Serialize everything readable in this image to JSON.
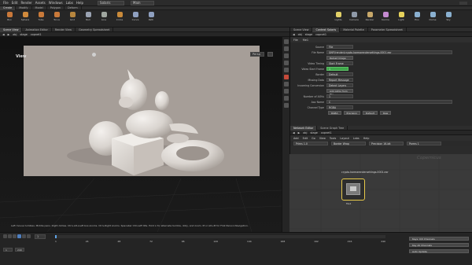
{
  "menu": {
    "items": [
      "File",
      "Edit",
      "Render",
      "Assets",
      "Windows",
      "Labs",
      "Help"
    ],
    "desktop": "Solaris",
    "context": "Main"
  },
  "shelf": {
    "tabs": [
      "Create",
      "Modify",
      "Model",
      "Polygon",
      "Deform"
    ],
    "tools": [
      {
        "label": "Box",
        "color": "#c9783a"
      },
      {
        "label": "Sphere",
        "color": "#d08a3c"
      },
      {
        "label": "Tube",
        "color": "#c97a3a"
      },
      {
        "label": "Torus",
        "color": "#c97a3a"
      },
      {
        "label": "Grid",
        "color": "#b7863e"
      },
      {
        "label": "Null",
        "color": "#9aa3b2"
      },
      {
        "label": "Line",
        "color": "#a0a7a0"
      },
      {
        "label": "Circle",
        "color": "#c98a3a"
      },
      {
        "label": "Curve",
        "color": "#8fa0c0"
      },
      {
        "label": "Path",
        "color": "#8fa0c0"
      }
    ],
    "right_tools": [
      {
        "label": "Lights",
        "color": "#e1d067"
      },
      {
        "label": "Camera",
        "color": "#909aa8"
      },
      {
        "label": "Render",
        "color": "#c8a86a"
      },
      {
        "label": "Karma",
        "color": "#c48ad0"
      },
      {
        "label": "Light",
        "color": "#e7d35c"
      },
      {
        "label": "Env",
        "color": "#8ab0d0"
      },
      {
        "label": "Dome",
        "color": "#8ab0d0"
      },
      {
        "label": "Sky",
        "color": "#8ab0d0"
      }
    ]
  },
  "viewer": {
    "tabs": [
      "Scene View",
      "Animation Editor",
      "Render View",
      "Geometry Spreadsheet"
    ],
    "path": [
      "obj",
      "stage",
      "copnet1"
    ],
    "title": "View",
    "camera": "Persp",
    "tip": "Left mouse tumbles. Middle pans. Right dollies. Ctrl+Alt+Left box-zooms. Ctrl+Right zooms. Spacebar Ctrl-Left tilts. Hold L for alternate tumble, dolly, and zoom. M or Alt+M for First Person Navigation."
  },
  "params": {
    "tabs": [
      "Scene View",
      "Context Solaris",
      "Material Palette",
      "Parameter Spreadsheet"
    ],
    "node_type": "File",
    "node_name": "file1",
    "rows": [
      {
        "label": "Source",
        "value": "File"
      },
      {
        "label": "File Name",
        "value": "$HIP/render/crypto.karmarendersettings.0001.exr"
      },
      {
        "label": "",
        "value": "Reload Image"
      },
      {
        "label": "Video Timing",
        "value": "Start Frame"
      },
      {
        "label": "Video Start Frame",
        "value": "1"
      },
      {
        "label": "Border",
        "value": "Default"
      },
      {
        "label": "Missing Data",
        "value": "Report Message"
      },
      {
        "label": "Incoming Conversion",
        "value": "Detect Layers"
      },
      {
        "label": "",
        "value": "Add AOVs from File"
      },
      {
        "label": "Number of AOVs",
        "value": "1"
      },
      {
        "label": "Aov Name",
        "value": "C"
      },
      {
        "label": "Channel Type",
        "value": "RGBA"
      }
    ],
    "channel_options": [
      "RGBA",
      "Precision",
      "Default",
      "Raw"
    ]
  },
  "network": {
    "tabs": [
      "Network Editor",
      "Scene Graph Tree"
    ],
    "path": [
      "obj",
      "stage",
      "copnet1"
    ],
    "menu": [
      "Add",
      "Edit",
      "Go",
      "View",
      "Tools",
      "Layout",
      "Labs",
      "Help"
    ],
    "fields": [
      "Prims 1.0",
      "Border Wrap",
      "Precision 16-bit",
      "Parms 1"
    ],
    "context_label": "Copernicus",
    "node_label": "crypto.karmarendersettings.0001.exr",
    "node_name": "file1"
  },
  "timeline": {
    "frame": "1",
    "start": "1",
    "end": "240",
    "ticks": [
      "1",
      "24",
      "48",
      "72",
      "96",
      "120",
      "144",
      "168",
      "192",
      "216",
      "240"
    ],
    "right_fields": [
      "Keys: 0/0 Channels",
      "Key All Channels",
      "Auto Update"
    ]
  },
  "colors": {
    "render_bg": "#a69e98",
    "node_active": "#e7c94a",
    "green_field": "#3fa64a"
  }
}
